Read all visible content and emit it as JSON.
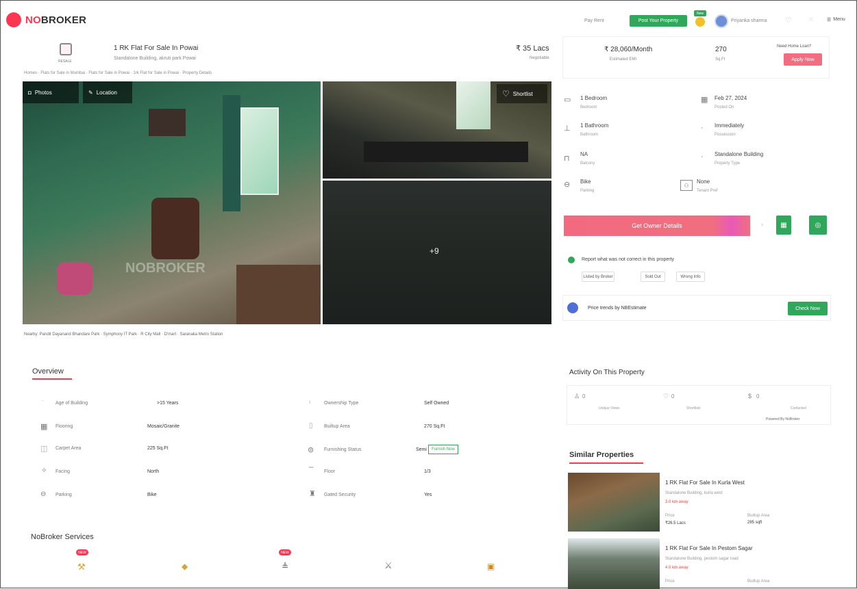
{
  "header": {
    "brand_prefix": "NO",
    "brand_suffix": "BROKER",
    "pay_rent": "Pay Rent",
    "post_property": "Post Your Property",
    "badge_new": "New",
    "user_name": "Priyanka sharma",
    "menu_label": "Menu"
  },
  "listing": {
    "icon_caption": "RESALE",
    "title": "1 RK Flat For Sale In Powai",
    "subtitle": "Standalone Building, akruti park Powai",
    "price": "₹ 35 Lacs",
    "price_sub": "Negotiable",
    "breadcrumb": "Homes · Flats for Sale in Mumbai · Flats for Sale in Powai · 1rk Flat for Sale in Powai · Property Details",
    "emi": "₹ 28,060/Month",
    "emi_sub": "Estimated EMI",
    "area": "270",
    "area_sub": "Sq.Ft",
    "home_loan_q": "Need Home Loan?",
    "apply_now": "Apply Now"
  },
  "gallery": {
    "photos_label": "Photos",
    "location_label": "Location",
    "shortlist_label": "Shortlist",
    "more_count": "+9",
    "watermark": "NOBROKER",
    "nearby": "Nearby: Pandit Dayanand Bhandare Park · Symphony IT Park · R City Mall · D'mart · Saranaka Metro Station"
  },
  "details": [
    {
      "value": "1 Bedroom",
      "label": "Bedroom",
      "icon": "bed-icon"
    },
    {
      "value": "Feb 27, 2024",
      "label": "Posted On",
      "icon": "calendar-icon"
    },
    {
      "value": "1 Bathroom",
      "label": "Bathroom",
      "icon": "bath-icon"
    },
    {
      "value": "Immediately",
      "label": "Possession",
      "icon": "key-icon"
    },
    {
      "value": "NA",
      "label": "Balcony",
      "icon": "door-icon"
    },
    {
      "value": "Standalone Building",
      "label": "Property Type",
      "icon": "building-icon"
    },
    {
      "value": "Bike",
      "label": "Parking",
      "icon": "car-icon"
    },
    {
      "value": "None",
      "label": "Tenant Pref",
      "icon": "users-icon"
    }
  ],
  "actions": {
    "owner_details": "Get Owner Details",
    "report_text": "Report what was not correct in this property",
    "report_options": [
      "Listed by Broker",
      "Sold Out",
      "Wrong Info"
    ],
    "price_trends": "Price trends by NBEstimate",
    "check_now": "Check Now"
  },
  "activity": {
    "title": "Activity On This Property",
    "items": [
      {
        "count": "0",
        "label": "Unique Views",
        "icon": "person-icon"
      },
      {
        "count": "0",
        "label": "Shortlists",
        "icon": "heart-icon"
      },
      {
        "count": "0",
        "label": "Contacted",
        "icon": "contact-icon"
      }
    ],
    "powered": "Powered By NoBroker"
  },
  "overview": {
    "title": "Overview",
    "rows_left": [
      {
        "label": "Age of Building",
        "value": ">15 Years",
        "icon": "clock-icon"
      },
      {
        "label": "Flooring",
        "value": "Mosaic/Granite",
        "icon": "grid-icon"
      },
      {
        "label": "Carpet Area",
        "value": "225 Sq.Ft",
        "icon": "area-icon"
      },
      {
        "label": "Facing",
        "value": "North",
        "icon": "compass-icon"
      },
      {
        "label": "Parking",
        "value": "Bike",
        "icon": "car-icon"
      }
    ],
    "rows_right": [
      {
        "label": "Ownership Type",
        "value": "Self Owned",
        "icon": "owner-icon"
      },
      {
        "label": "Builtup Area",
        "value": "270 Sq.Ft",
        "icon": "ruler-icon"
      },
      {
        "label": "Furnishing Status",
        "value": "Semi",
        "icon": "sofa-icon"
      },
      {
        "label": "Floor",
        "value": "1/3",
        "icon": "floor-icon"
      },
      {
        "label": "Gated Security",
        "value": "Yes",
        "icon": "guard-icon"
      }
    ],
    "furnish_btn": "Furnish Now"
  },
  "services": {
    "title": "NoBroker Services",
    "new_badge": "NEW",
    "items": [
      "hammer-icon",
      "paint-icon",
      "clean-icon",
      "tools-icon",
      "pack-icon"
    ]
  },
  "similar": {
    "title": "Similar Properties",
    "items": [
      {
        "title": "1 RK Flat For Sale In Kurla West",
        "sub": "Standalone Building, kurla west",
        "dist": "3.0 km away",
        "price_label": "Price",
        "price": "₹26.5 Lacs",
        "area_label": "Builtup Area",
        "area": "285 sqft"
      },
      {
        "title": "1 RK Flat For Sale In Pestom Sagar",
        "sub": "Standalone Building, pestom sagar road",
        "dist": "4.0 km away",
        "price_label": "Price",
        "price": "",
        "area_label": "Builtup Area",
        "area": ""
      }
    ]
  }
}
